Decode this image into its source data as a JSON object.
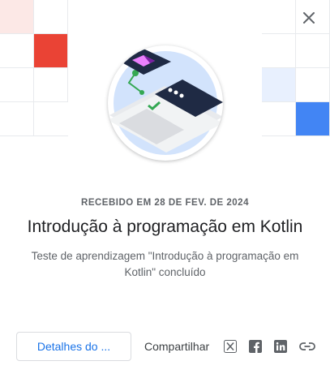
{
  "icons": {
    "close": "close-icon",
    "share": [
      "x-twitter-icon",
      "facebook-icon",
      "linkedin-icon",
      "link-icon"
    ]
  },
  "colors": {
    "accent_blue": "#1a73e8",
    "grid_red": "#ea4335",
    "grid_pink": "#fce8e6",
    "grid_blue": "#4285f4",
    "grid_light_blue": "#e8f0fe"
  },
  "badge": {
    "received_text": "RECEBIDO EM 28 DE FEV. DE 2024",
    "title": "Introdução à programação em Kotlin",
    "subtitle": "Teste de aprendizagem \"Introdução à programação em Kotlin\" concluído"
  },
  "actions": {
    "details_label": "Detalhes do ...",
    "share_label": "Compartilhar"
  }
}
